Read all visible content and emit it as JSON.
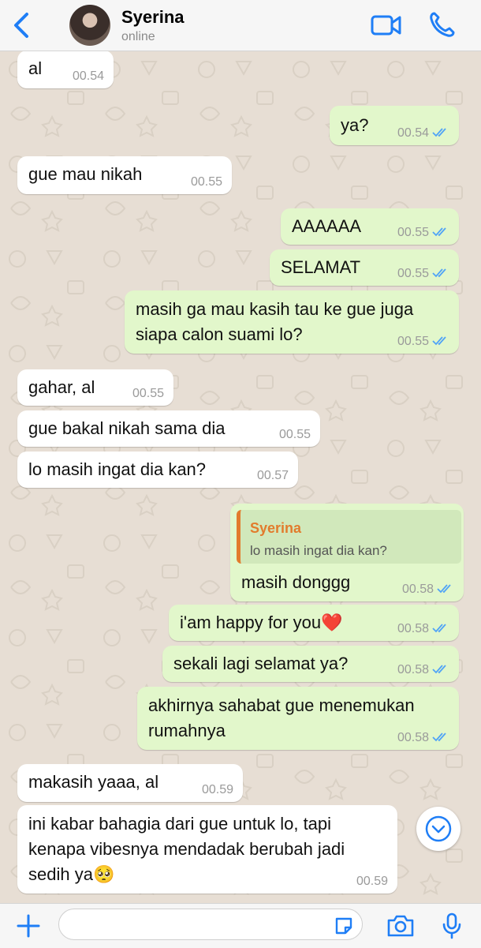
{
  "header": {
    "contact_name": "Syerina",
    "status": "online",
    "accent": "#1f7ef6"
  },
  "messages": [
    {
      "dir": "in",
      "text": "al",
      "time": "00.54"
    },
    {
      "dir": "out",
      "text": "ya?",
      "time": "00.54"
    },
    {
      "dir": "in",
      "text": "gue mau nikah",
      "time": "00.55"
    },
    {
      "dir": "out",
      "text": "AAAAAA",
      "time": "00.55"
    },
    {
      "dir": "out",
      "text": "SELAMAT",
      "time": "00.55"
    },
    {
      "dir": "out",
      "lines": [
        "masih ga mau kasih tau ke gue juga",
        "siapa calon suami lo?"
      ],
      "time": "00.55"
    },
    {
      "dir": "in",
      "text": "gahar, al",
      "time": "00.55"
    },
    {
      "dir": "in",
      "text": "gue bakal nikah sama dia",
      "time": "00.55"
    },
    {
      "dir": "in",
      "text": "lo masih ingat dia kan?",
      "time": "00.57"
    },
    {
      "dir": "out",
      "quote": {
        "author": "Syerina",
        "text": "lo masih ingat dia kan?"
      },
      "text": "masih donggg",
      "time": "00.58"
    },
    {
      "dir": "out",
      "text": "i'am happy for you",
      "emoji": "❤️",
      "time": "00.58"
    },
    {
      "dir": "out",
      "text": "sekali lagi selamat ya?",
      "time": "00.58"
    },
    {
      "dir": "out",
      "lines": [
        "akhirnya sahabat gue menemukan",
        "rumahnya"
      ],
      "time": "00.58"
    },
    {
      "dir": "in",
      "text": "makasih yaaa, al",
      "time": "00.59"
    },
    {
      "dir": "in",
      "lines": [
        "ini kabar bahagia dari gue untuk lo, tapi",
        "kenapa vibesnya mendadak berubah jadi",
        "sedih ya"
      ],
      "emoji": "🥺",
      "time": "00.59"
    }
  ],
  "colors": {
    "incoming": "#ffffff",
    "outgoing": "#e2f7cb",
    "read_ticks": "#4fa3f7",
    "quote_author": "#e27b2c"
  },
  "icons": [
    "chevron-left-icon",
    "video-camera-icon",
    "phone-icon",
    "chevron-down-icon",
    "plus-icon",
    "sticker-icon",
    "camera-icon",
    "microphone-icon"
  ]
}
